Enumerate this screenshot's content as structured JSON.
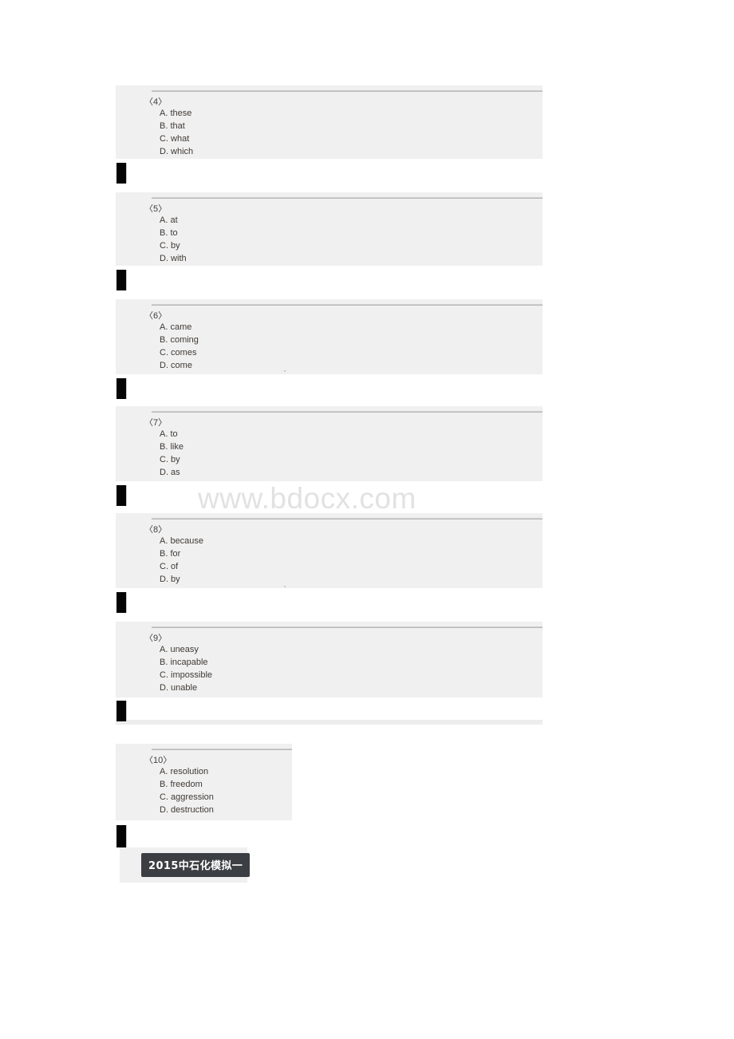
{
  "document": {
    "watermark": "www.bdocx.com",
    "footer_label": "2015中石化模拟一",
    "page_background": "#ffffff",
    "block_background": "#f0f0f0",
    "rule_color": "#b8b8b8",
    "marker_color": "#050505",
    "footer_chip_color": "#3b3f44",
    "text_color": "#3f3a36"
  },
  "questions": [
    {
      "number": "〈4〉",
      "options": [
        "A. these",
        "B. that",
        "C. what",
        "D. which"
      ]
    },
    {
      "number": "〈5〉",
      "options": [
        "A. at",
        "B. to",
        "C. by",
        "D. with"
      ]
    },
    {
      "number": "〈6〉",
      "options": [
        "A. came",
        "B. coming",
        "C. comes",
        "D. come"
      ]
    },
    {
      "number": "〈7〉",
      "options": [
        "A. to",
        "B. like",
        "C. by",
        "D. as"
      ]
    },
    {
      "number": "〈8〉",
      "options": [
        "A. because",
        "B. for",
        "C. of",
        "D. by"
      ]
    },
    {
      "number": "〈9〉",
      "options": [
        "A. uneasy",
        "B. incapable",
        "C. impossible",
        "D. unable"
      ]
    },
    {
      "number": "〈10〉",
      "options": [
        "A. resolution",
        "B. freedom",
        "C. aggression",
        "D. destruction"
      ]
    }
  ]
}
